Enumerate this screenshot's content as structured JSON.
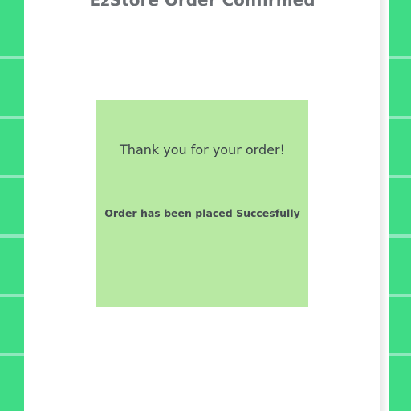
{
  "page": {
    "title": "EzStore Order Confirmed"
  },
  "confirmation": {
    "heading": "Thank you for your order!",
    "message": "Order has been placed Succesfully"
  },
  "colors": {
    "tile_green": "#3fdc86",
    "tile_gap": "#8fe8bd",
    "card_background": "#b8e9a3",
    "title_text": "#6b6f74",
    "body_text": "#3b4148"
  }
}
